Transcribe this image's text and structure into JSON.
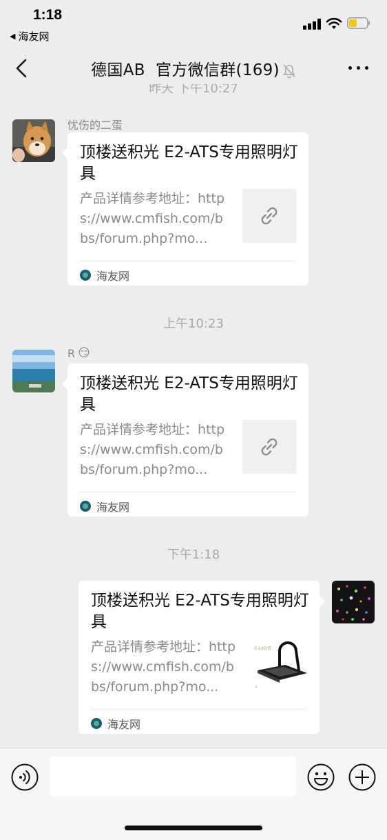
{
  "status_bar": {
    "time": "1:18",
    "back_app": "海友网",
    "back_arrow": "◀"
  },
  "nav": {
    "title": "德国AB  官方微信群(169)",
    "back_icon": "chevron-left-icon",
    "mute_icon": "bell-muted-icon",
    "more_icon": "more-dots-icon"
  },
  "messages": [
    {
      "timestamp_clipped": "昨天 下午10:27",
      "sender": "忧伤的二蛋",
      "side": "left",
      "title": "顶楼送积光 E2-ATS专用照明灯具",
      "desc": "产品详情参考地址：https://www.cmfish.com/bbs/forum.php?mo...",
      "source": "海友网",
      "thumb_icon": "link-icon"
    },
    {
      "timestamp": "上午10:23",
      "sender": "R",
      "sender_emoji": "😏",
      "side": "left",
      "title": "顶楼送积光 E2-ATS专用照明灯具",
      "desc": "产品详情参考地址：https://www.cmfish.com/bbs/forum.php?mo...",
      "source": "海友网",
      "thumb_icon": "link-icon"
    },
    {
      "timestamp": "下午1:18",
      "side": "right",
      "title": "顶楼送积光 E2-ATS专用照明灯具",
      "desc": "产品详情参考地址：https://www.cmfish.com/bbs/forum.php?mo...",
      "source": "海友网",
      "thumb_icon": "lamp-product-image"
    }
  ],
  "input_bar": {
    "voice_icon": "voice-icon",
    "emoji_icon": "emoji-icon",
    "plus_icon": "plus-icon"
  },
  "colors": {
    "background": "#ededed",
    "card": "#ffffff",
    "timestamp": "#a9a9a9",
    "source_icon": "#1e5a7a"
  }
}
